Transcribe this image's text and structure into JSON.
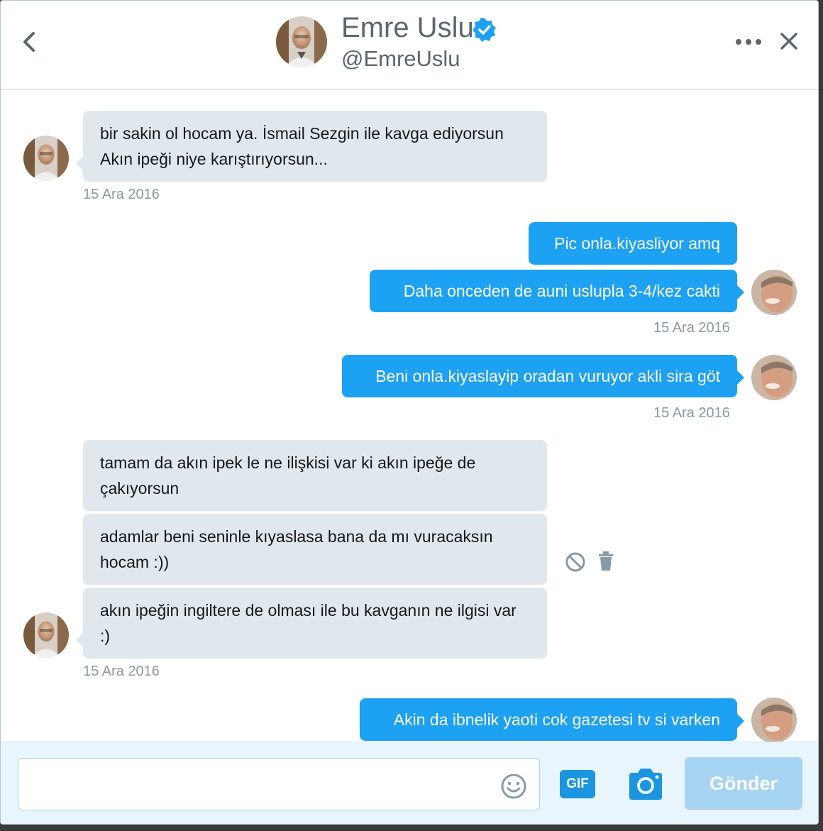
{
  "header": {
    "name": "Emre Uslu",
    "handle": "@EmreUslu",
    "verified": true
  },
  "messages": [
    {
      "direction": "in",
      "text": "bir sakin ol hocam ya. İsmail Sezgin ile kavga ediyorsun Akın ipeği niye karıştırıyorsun..."
    },
    {
      "direction": "in",
      "timestamp": "15 Ara 2016"
    },
    {
      "direction": "out",
      "text": "Pic onla.kiyasliyor amq"
    },
    {
      "direction": "out",
      "text": "Daha onceden de auni uslupla 3-4/kez cakti"
    },
    {
      "direction": "out",
      "timestamp": "15 Ara 2016"
    },
    {
      "direction": "out",
      "text": "Beni onla.kiyaslayip oradan vuruyor akli sira göt"
    },
    {
      "direction": "out",
      "timestamp": "15 Ara 2016"
    },
    {
      "direction": "in",
      "text": "tamam da akın ipek le ne ilişkisi var ki akın ipeğe de çakıyorsun"
    },
    {
      "direction": "in",
      "text": "adamlar beni seninle kıyaslasa bana da mı vuracaksın hocam :))"
    },
    {
      "direction": "in",
      "text": "akın ipeğin ingiltere de olması ile bu kavganın ne ilgisi var :)"
    },
    {
      "direction": "in",
      "timestamp": "15 Ara 2016"
    },
    {
      "direction": "out",
      "text": "Akin da ibnelik yaoti cok gazetesi tv si varken"
    }
  ],
  "composer": {
    "placeholder": "",
    "gif_label": "GIF",
    "send_label": "Gönder"
  },
  "colors": {
    "brand_blue": "#1da1f2",
    "incoming_bubble": "#e1e8ed",
    "timestamp": "#8899a6",
    "send_disabled": "#a6d4f2"
  },
  "icons": [
    "back-icon",
    "verified-badge-icon",
    "more-icon",
    "close-icon",
    "block-icon",
    "trash-icon",
    "emoji-icon",
    "gif-icon",
    "camera-icon"
  ]
}
